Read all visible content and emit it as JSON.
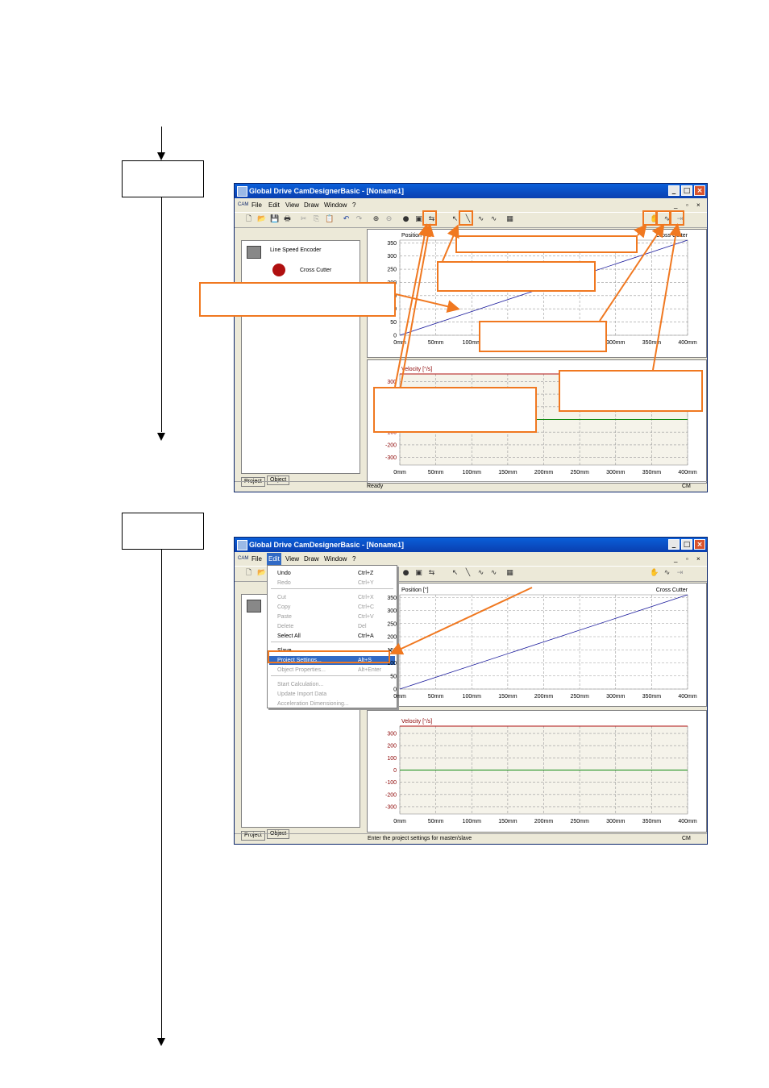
{
  "window": {
    "title": "Global Drive CamDesignerBasic - [Noname1]",
    "menus": [
      "File",
      "Edit",
      "View",
      "Draw",
      "Window",
      "?"
    ],
    "tabs": [
      "Project",
      "Object"
    ],
    "project_tree": [
      "Line Speed Encoder",
      "Cross Cutter"
    ],
    "status_ready": "Ready",
    "status_settings": "Enter the project settings for master/slave",
    "status_mode": "CM"
  },
  "chart_data": [
    {
      "type": "line",
      "ylabel": "Position [°]",
      "series_label": "Cross Cutter",
      "x_ticks": [
        "0mm",
        "50mm",
        "100mm",
        "150mm",
        "200mm",
        "250mm",
        "300mm",
        "350mm",
        "400mm"
      ],
      "y_ticks": [
        "0",
        "50",
        "100",
        "150",
        "200",
        "250",
        "300",
        "350"
      ],
      "x": [
        0,
        400
      ],
      "y": [
        0,
        360
      ],
      "xlim": [
        0,
        400
      ],
      "ylim": [
        0,
        360
      ],
      "grid": true,
      "color": "#1a1a9c"
    },
    {
      "type": "line",
      "ylabel": "Velocity [°/s]",
      "x_ticks": [
        "0mm",
        "50mm",
        "100mm",
        "150mm",
        "200mm",
        "250mm",
        "300mm",
        "350mm",
        "400mm"
      ],
      "y_ticks": [
        "300",
        "200",
        "100",
        "0",
        "-100",
        "-200",
        "-300"
      ],
      "series": [
        {
          "values": [
            360,
            360
          ],
          "color": "#b01010"
        },
        {
          "values": [
            0,
            0
          ],
          "color": "#108a10"
        }
      ],
      "x": [
        0,
        400
      ],
      "xlim": [
        0,
        400
      ],
      "ylim": [
        -360,
        360
      ],
      "grid": true
    }
  ],
  "edit_menu": {
    "items": [
      {
        "label": "Undo",
        "shortcut": "Ctrl+Z",
        "enabled": true
      },
      {
        "label": "Redo",
        "shortcut": "Ctrl+Y",
        "enabled": false
      },
      {
        "label": "Cut",
        "shortcut": "Ctrl+X",
        "enabled": false
      },
      {
        "label": "Copy",
        "shortcut": "Ctrl+C",
        "enabled": false
      },
      {
        "label": "Paste",
        "shortcut": "Ctrl+V",
        "enabled": false
      },
      {
        "label": "Delete",
        "shortcut": "Del",
        "enabled": false
      },
      {
        "label": "Select All",
        "shortcut": "Ctrl+A",
        "enabled": true
      },
      {
        "label": "Slave...",
        "shortcut": "",
        "enabled": true
      },
      {
        "label": "Project Settings...",
        "shortcut": "Alt+S",
        "enabled": true,
        "selected": true
      },
      {
        "label": "Object Properties...",
        "shortcut": "Alt+Enter",
        "enabled": false
      },
      {
        "label": "Start Calculation...",
        "shortcut": "",
        "enabled": false
      },
      {
        "label": "Update Import Data",
        "shortcut": "",
        "enabled": false
      },
      {
        "label": "Acceleration Dimensioning...",
        "shortcut": "",
        "enabled": false
      }
    ]
  },
  "colors": {
    "callout": "#f07820",
    "title_bar": "#0a4fc8",
    "highlight": "#316ac5"
  }
}
